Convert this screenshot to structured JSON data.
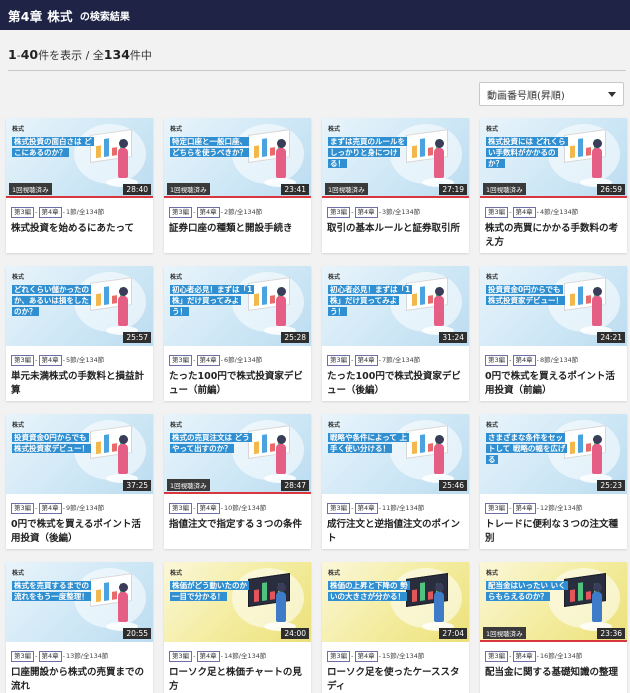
{
  "header": {
    "title": "第4章 株式",
    "subtitle": "の検索結果"
  },
  "results": {
    "range_start": "1",
    "range_sep": "-",
    "range_end": "40",
    "mid": "件を表示 / 全",
    "total": "134",
    "tail": "件中"
  },
  "sort": {
    "selected": "動画番号順(昇順)"
  },
  "colors": {
    "header_bg": "#1f2447",
    "caption_bg": "#2f8fd1",
    "progress": "#d9363e"
  },
  "cards": [
    {
      "theme": "blue",
      "tag": "株式",
      "caption": "株式投資の面白さは どこにあるのか？",
      "watched": "1回視聴済み",
      "progress": 1,
      "duration": "28:40",
      "part": "第3編",
      "chapter": "第4章",
      "position": "1節/全134節",
      "title": "株式投資を始めるにあたって"
    },
    {
      "theme": "blue",
      "tag": "株式",
      "caption": "特定口座と一般口座、どちらを使うべきか？",
      "watched": "1回視聴済み",
      "progress": 1,
      "duration": "23:41",
      "part": "第3編",
      "chapter": "第4章",
      "position": "2節/全134節",
      "title": "証券口座の種類と開設手続き"
    },
    {
      "theme": "blue",
      "tag": "株式",
      "caption": "まずは売買のルールを しっかりと身につける！",
      "watched": "1回視聴済み",
      "progress": 1,
      "duration": "27:19",
      "part": "第3編",
      "chapter": "第4章",
      "position": "3節/全134節",
      "title": "取引の基本ルールと証券取引所"
    },
    {
      "theme": "blue",
      "tag": "株式",
      "caption": "株式投資には どれくらい手数料がかかるのか？",
      "watched": "1回視聴済み",
      "progress": 1,
      "duration": "26:59",
      "part": "第3編",
      "chapter": "第4章",
      "position": "4節/全134節",
      "title": "株式の売買にかかる手数料の考え方"
    },
    {
      "theme": "blue",
      "tag": "株式",
      "caption": "どれくらい儲かったのか、あるいは損をしたのか？",
      "watched": "",
      "progress": 0,
      "duration": "25:57",
      "part": "第3編",
      "chapter": "第4章",
      "position": "5節/全134節",
      "title": "単元未満株式の手数料と損益計算"
    },
    {
      "theme": "blue",
      "tag": "株式",
      "caption": "初心者必見！まずは「1株」だけ買ってみよう！",
      "watched": "",
      "progress": 0,
      "duration": "25:28",
      "part": "第3編",
      "chapter": "第4章",
      "position": "6節/全134節",
      "title": "たった100円で株式投資家デビュー（前編）"
    },
    {
      "theme": "blue",
      "tag": "株式",
      "caption": "初心者必見！まずは「1株」だけ買ってみよう！",
      "watched": "",
      "progress": 0,
      "duration": "31:24",
      "part": "第3編",
      "chapter": "第4章",
      "position": "7節/全134節",
      "title": "たった100円で株式投資家デビュー（後編）"
    },
    {
      "theme": "blue",
      "tag": "株式",
      "caption": "投資資金0円からでも 株式投資家デビュー！",
      "watched": "",
      "progress": 0,
      "duration": "24:21",
      "part": "第3編",
      "chapter": "第4章",
      "position": "8節/全134節",
      "title": "0円で株式を買えるポイント活用投資（前編）"
    },
    {
      "theme": "blue",
      "tag": "株式",
      "caption": "投資資金0円からでも 株式投資家デビュー！",
      "watched": "",
      "progress": 0,
      "duration": "37:25",
      "part": "第3編",
      "chapter": "第4章",
      "position": "9節/全134節",
      "title": "0円で株式を買えるポイント活用投資（後編）"
    },
    {
      "theme": "blue",
      "tag": "株式",
      "caption": "株式の売買注文は どうやって出すのか？",
      "watched": "1回視聴済み",
      "progress": 1,
      "duration": "28:47",
      "part": "第3編",
      "chapter": "第4章",
      "position": "10節/全134節",
      "title": "指値注文で指定する３つの条件"
    },
    {
      "theme": "blue",
      "tag": "株式",
      "caption": "戦略や条件によって 上手く使い分ける！",
      "watched": "",
      "progress": 0,
      "duration": "25:46",
      "part": "第3編",
      "chapter": "第4章",
      "position": "11節/全134節",
      "title": "成行注文と逆指値注文のポイント"
    },
    {
      "theme": "blue",
      "tag": "株式",
      "caption": "さまざまな条件をセットして 戦略の幅を広げる",
      "watched": "",
      "progress": 0,
      "duration": "25:23",
      "part": "第3編",
      "chapter": "第4章",
      "position": "12節/全134節",
      "title": "トレードに便利な３つの注文種別"
    },
    {
      "theme": "blue",
      "tag": "株式",
      "caption": "株式を売買するまでの 流れをもう一度整理！",
      "watched": "",
      "progress": 0,
      "duration": "20:55",
      "part": "第3編",
      "chapter": "第4章",
      "position": "13節/全134節",
      "title": "口座開設から株式の売買までの流れ"
    },
    {
      "theme": "yellow",
      "tag": "株式",
      "caption": "株価がどう動いたのか 一目で分かる！",
      "watched": "",
      "progress": 0,
      "duration": "24:00",
      "part": "第3編",
      "chapter": "第4章",
      "position": "14節/全134節",
      "title": "ローソク足と株価チャートの見方"
    },
    {
      "theme": "yellow",
      "tag": "株式",
      "caption": "株価の上昇と下降の 勢いの大きさが分かる！",
      "watched": "",
      "progress": 0,
      "duration": "27:04",
      "part": "第3編",
      "chapter": "第4章",
      "position": "15節/全134節",
      "title": "ローソク足を使ったケーススタディ"
    },
    {
      "theme": "yellow",
      "tag": "株式",
      "caption": "配当金はいったい いくらもらえるのか？",
      "watched": "1回視聴済み",
      "progress": 1,
      "duration": "23:36",
      "part": "第3編",
      "chapter": "第4章",
      "position": "16節/全134節",
      "title": "配当金に関する基礎知識の整理"
    }
  ]
}
